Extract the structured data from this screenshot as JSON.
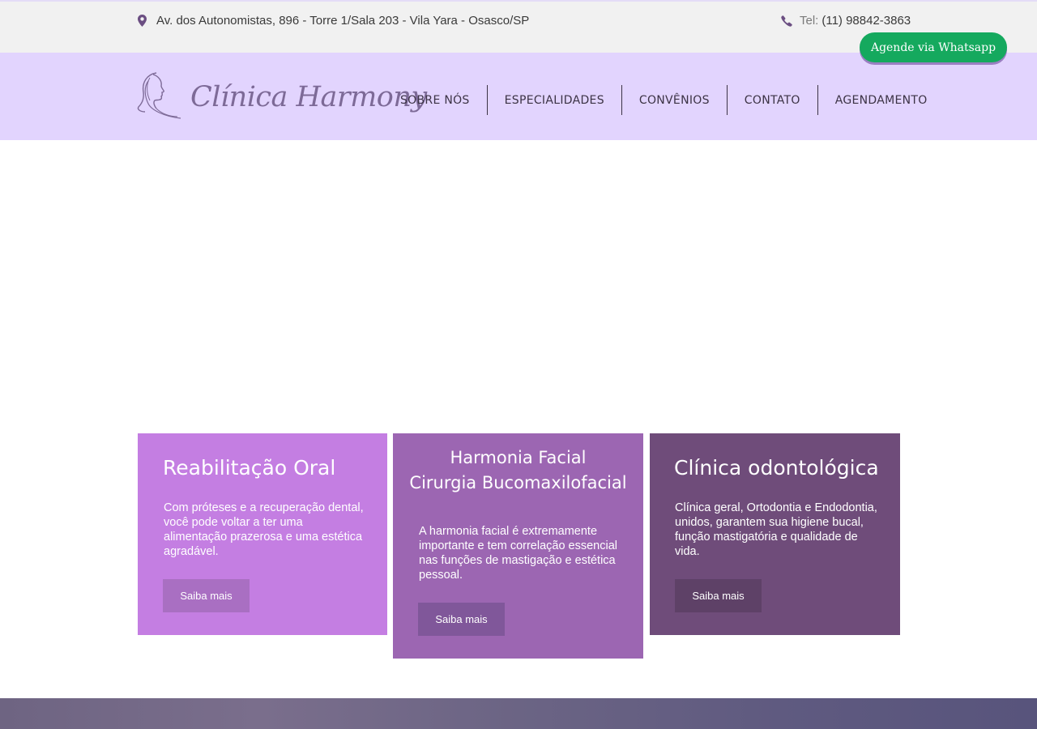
{
  "topbar": {
    "address": "Av. dos Autonomistas, 896 - Torre 1/Sala 203 - Vila Yara - Osasco/SP",
    "address_icon": "map-pin-icon",
    "phone_label": "Tel:",
    "phone_number": "(11) 98842-3863",
    "phone_icon": "phone-icon"
  },
  "whatsapp_button": {
    "label": "Agende via Whatsapp"
  },
  "header": {
    "logo_text": "Clínica Harmony",
    "nav": [
      {
        "label": "SOBRE NÓS"
      },
      {
        "label": "ESPECIALIDADES"
      },
      {
        "label": "CONVÊNIOS"
      },
      {
        "label": "CONTATO"
      },
      {
        "label": "AGENDAMENTO"
      }
    ]
  },
  "cards": [
    {
      "title": "Reabilitação Oral",
      "text": "Com próteses e a recuperação dental, você pode voltar a ter uma alimentação prazerosa e uma estética agradável.",
      "button": "Saiba mais"
    },
    {
      "title_line1": "Harmonia Facial",
      "title_line2": "Cirurgia Bucomaxilofacial",
      "text": "A harmonia facial é extremamente importante e tem correlação essencial nas funções de mastigação e estética pessoal.",
      "button": "Saiba mais"
    },
    {
      "title": "Clínica odontológica",
      "text": "Clínica geral, Ortodontia e Endodontia, unidos, garantem sua higiene bucal, função mastigatória e qualidade de vida.",
      "button": "Saiba mais"
    }
  ],
  "colors": {
    "header_bg": "#e2d4fe",
    "whatsapp_green": "#15a95e",
    "card1": "#c47ee2",
    "card2": "#9c66b2",
    "card3": "#6f4c7a"
  }
}
